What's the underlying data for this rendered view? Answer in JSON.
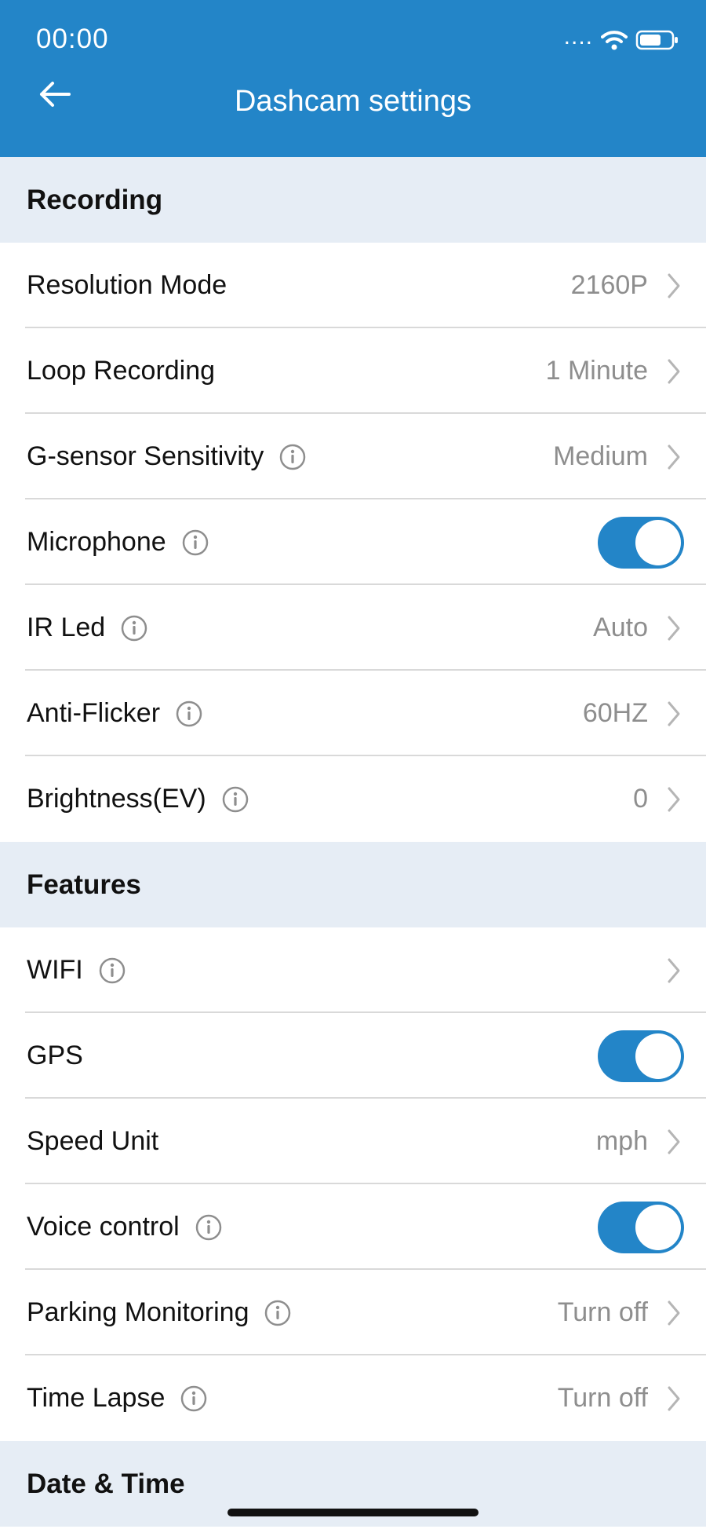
{
  "status_bar": {
    "time": "00:00",
    "signal": "....",
    "wifi_icon": "wifi-icon",
    "battery_icon": "battery-icon"
  },
  "nav": {
    "back_icon": "arrow-left-icon",
    "title": "Dashcam settings"
  },
  "colors": {
    "header": "#2385c8",
    "section_bg": "#e6edf5",
    "toggle_on": "#2385c8",
    "value_text": "#8e8e8e"
  },
  "sections": [
    {
      "title": "Recording",
      "items": [
        {
          "label": "Resolution Mode",
          "info": false,
          "value": "2160P",
          "type": "chevron"
        },
        {
          "label": "Loop Recording",
          "info": false,
          "value": "1 Minute",
          "type": "chevron"
        },
        {
          "label": "G-sensor Sensitivity",
          "info": true,
          "value": "Medium",
          "type": "chevron"
        },
        {
          "label": "Microphone",
          "info": true,
          "value": "",
          "type": "toggle",
          "on": true
        },
        {
          "label": "IR Led",
          "info": true,
          "value": "Auto",
          "type": "chevron"
        },
        {
          "label": "Anti-Flicker",
          "info": true,
          "value": "60HZ",
          "type": "chevron"
        },
        {
          "label": "Brightness(EV)",
          "info": true,
          "value": "0",
          "type": "chevron"
        }
      ]
    },
    {
      "title": "Features",
      "items": [
        {
          "label": "WIFI",
          "info": true,
          "value": "",
          "type": "chevron"
        },
        {
          "label": "GPS",
          "info": false,
          "value": "",
          "type": "toggle",
          "on": true
        },
        {
          "label": "Speed Unit",
          "info": false,
          "value": "mph",
          "type": "chevron"
        },
        {
          "label": "Voice control",
          "info": true,
          "value": "",
          "type": "toggle",
          "on": true
        },
        {
          "label": "Parking Monitoring",
          "info": true,
          "value": "Turn off",
          "type": "chevron"
        },
        {
          "label": "Time Lapse",
          "info": true,
          "value": "Turn off",
          "type": "chevron"
        }
      ]
    },
    {
      "title": "Date & Time",
      "items": []
    }
  ]
}
